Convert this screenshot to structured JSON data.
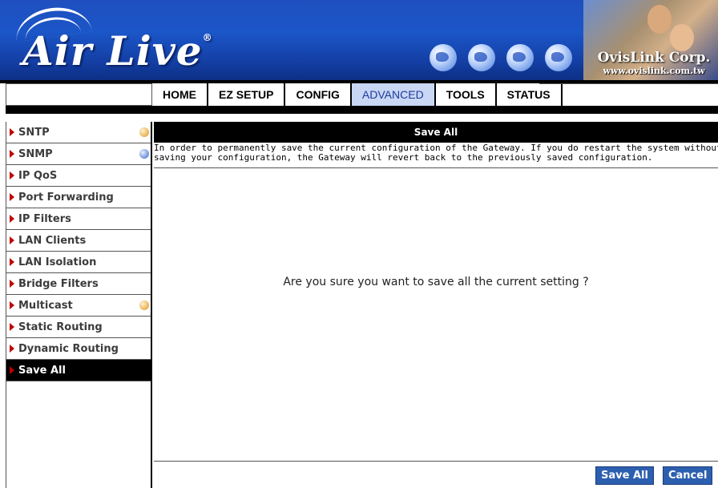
{
  "header": {
    "logo_text": "Air Live",
    "logo_mark": "®",
    "company": "OvisLink Corp.",
    "company_url": "www.ovislink.com.tw",
    "colors": {
      "banner": "#1b56c8",
      "accent_red": "#c00000",
      "button_blue": "#2d5fb0"
    }
  },
  "nav": {
    "tabs": [
      {
        "label": "HOME"
      },
      {
        "label": "EZ SETUP"
      },
      {
        "label": "CONFIG"
      },
      {
        "label": "ADVANCED",
        "active": true
      },
      {
        "label": "TOOLS"
      },
      {
        "label": "STATUS"
      }
    ]
  },
  "sidebar": {
    "items": [
      {
        "label": "SNTP",
        "indicator": "orange"
      },
      {
        "label": "SNMP",
        "indicator": "blue"
      },
      {
        "label": "IP QoS"
      },
      {
        "label": "Port Forwarding"
      },
      {
        "label": "IP Filters"
      },
      {
        "label": "LAN Clients"
      },
      {
        "label": "LAN Isolation"
      },
      {
        "label": "Bridge Filters"
      },
      {
        "label": "Multicast",
        "indicator": "orange"
      },
      {
        "label": "Static Routing"
      },
      {
        "label": "Dynamic Routing"
      },
      {
        "label": "Save All",
        "active": true
      }
    ]
  },
  "main": {
    "title": "Save All",
    "description_line1": "In order to permanently save the current configuration of the Gateway. If you do restart the system without",
    "description_line2": "saving your configuration, the Gateway will revert back to the previously saved configuration.",
    "question": "Are you sure you want to save all the current setting ?",
    "save_button": "Save All",
    "cancel_button": "Cancel"
  }
}
